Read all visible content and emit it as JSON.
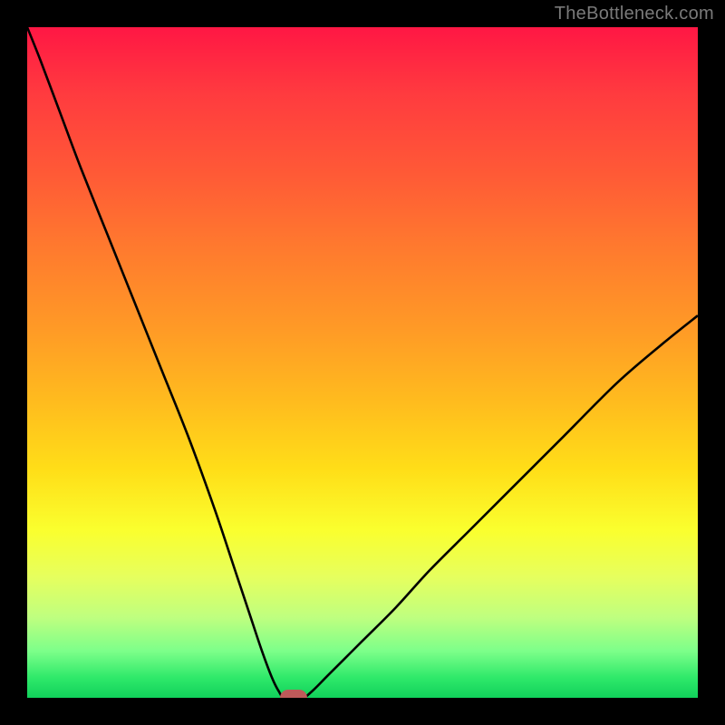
{
  "watermark": "TheBottleneck.com",
  "chart_data": {
    "type": "line",
    "title": "",
    "xlabel": "",
    "ylabel": "",
    "xlim": [
      0,
      100
    ],
    "ylim": [
      0,
      100
    ],
    "grid": false,
    "legend": false,
    "series": [
      {
        "name": "bottleneck-curve",
        "x": [
          0,
          2,
          5,
          8,
          12,
          16,
          20,
          24,
          28,
          31,
          33,
          35,
          36.5,
          37.5,
          38.4,
          41,
          42.5,
          45,
          50,
          55,
          60,
          66,
          73,
          80,
          88,
          95,
          100
        ],
        "y": [
          100,
          95,
          87,
          79,
          69,
          59,
          49,
          39,
          28,
          19,
          13,
          7,
          3,
          1,
          0,
          0,
          1,
          3.5,
          8.5,
          13.5,
          19,
          25,
          32,
          39,
          47,
          53,
          57
        ],
        "color": "#000000"
      }
    ],
    "marker": {
      "x": 39.7,
      "y": 0,
      "color": "#bf5a5a"
    }
  }
}
